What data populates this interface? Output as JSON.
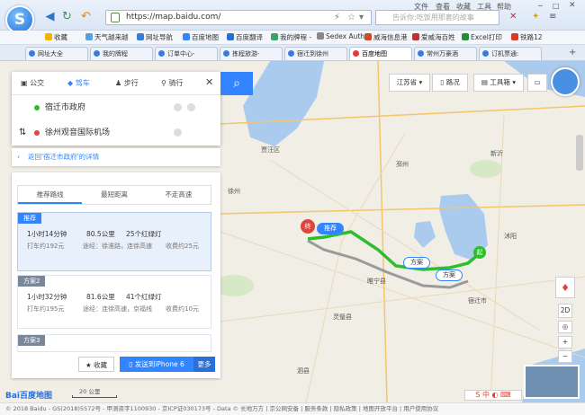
{
  "browser": {
    "url": "https://map.baidu.com/",
    "search_placeholder": "告诉你:吃饭用那套的故事",
    "menu": [
      "文件",
      "查看",
      "收藏",
      "工具",
      "帮助"
    ],
    "favorites": [
      "收藏",
      "天气越来越",
      "网址导航",
      "百度地图",
      "百度翻译",
      "我的牌程 -",
      "Sedex Auth",
      "威海信息港",
      "爱威海百姓",
      "Excel打印",
      "铁路12"
    ],
    "tabs": [
      "网址大全",
      "我的牌程",
      "订单中心-",
      "拣程旅游-",
      "宿迁到徐州",
      "百度地图",
      "常州万豪酒",
      "订机票通:"
    ],
    "active_tab": 5
  },
  "search_panel": {
    "modes": [
      "公交",
      "驾车",
      "步行",
      "骑行"
    ],
    "active_mode": 1,
    "origin": "宿迁市政府",
    "destination": "徐州观音国际机场",
    "back_link": "返回'宿迁市政府'的详情"
  },
  "routes": {
    "tabs": [
      "推荐路线",
      "最短距离",
      "不走高速"
    ],
    "items": [
      {
        "tag": "推荐",
        "time": "1小时14分钟",
        "distance": "80.5公里",
        "lights": "25个红绿灯",
        "taxi": "打车约192元",
        "via": "途经：徐淮路，连徐高速",
        "toll": "收费约25元"
      },
      {
        "tag": "方案2",
        "time": "1小时32分钟",
        "distance": "81.6公里",
        "lights": "41个红绿灯",
        "taxi": "打车约195元",
        "via": "途经：连徐高速，京福线",
        "toll": "收费约10元"
      },
      {
        "tag": "方案3"
      }
    ],
    "favorite": "收藏",
    "send": "发送到iPhone 6",
    "more": "更多"
  },
  "map": {
    "province": "江苏省",
    "traffic": "路况",
    "toolbox": "工具箱",
    "labels": {
      "r1": "推荐",
      "r2": "方案",
      "r3": "方案",
      "start": "终",
      "end": "起"
    },
    "scale": "20 公里",
    "zoom_plus": "+",
    "zoom_minus": "−",
    "view2d": "2D",
    "logo": "Bai百度地图",
    "copyright": "© 2018 Baidu - GS(2018)5572号 - 甲测资字1100930 - 京ICP证030173号 - Data © 长地万方 | 京公网安备 | 服务条款 | 隐私政策 | 地图开放平台 | 用户使用协议"
  },
  "colors": {
    "accent": "#3385ff",
    "route": "#2dbd2d",
    "alt": "#9a9a9a"
  }
}
